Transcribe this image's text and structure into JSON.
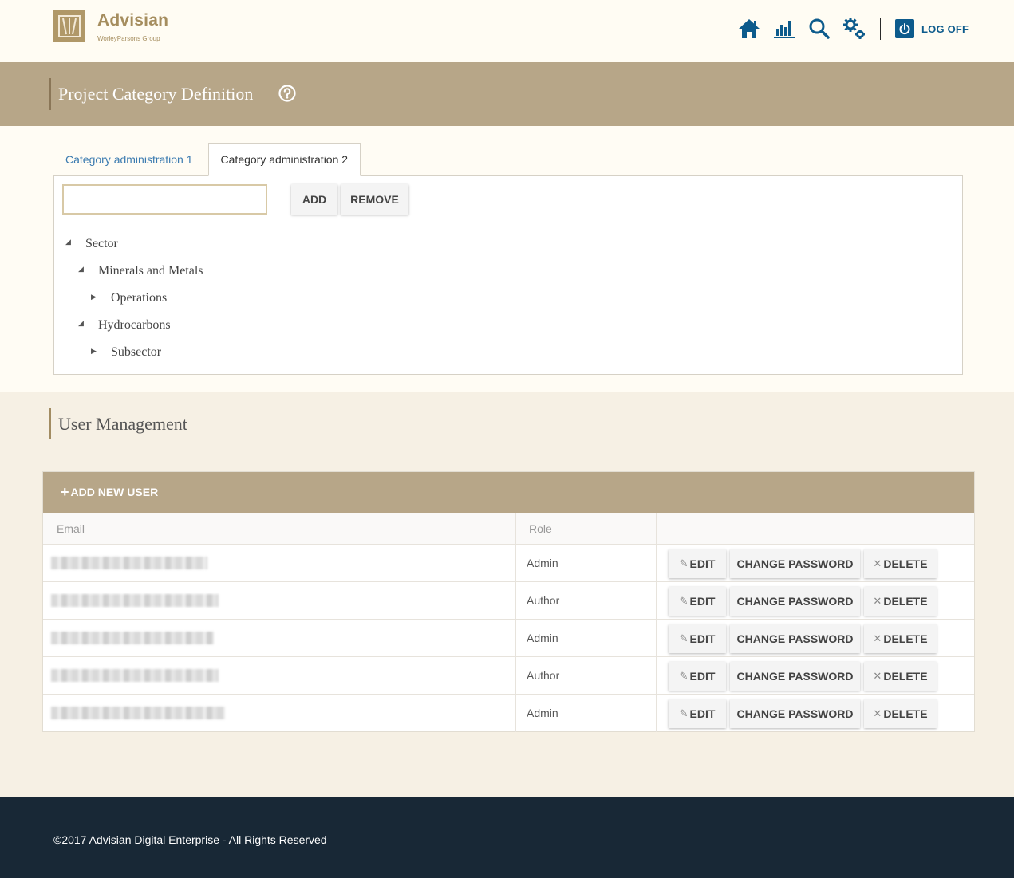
{
  "header": {
    "brand_name": "Advisian",
    "brand_sub": "WorleyParsons Group",
    "nav": [
      {
        "icon": "home-icon"
      },
      {
        "icon": "chart-icon"
      },
      {
        "icon": "search-icon"
      },
      {
        "icon": "gears-icon"
      }
    ],
    "logoff_label": "LOG OFF"
  },
  "title_band": {
    "title": "Project Category Definition",
    "help_icon": "question-circle-icon"
  },
  "categories": {
    "tabs": [
      {
        "label": "Category administration 1",
        "active": false
      },
      {
        "label": "Category administration 2",
        "active": true
      }
    ],
    "input_value": "",
    "add_label": "ADD",
    "remove_label": "REMOVE",
    "tree": [
      {
        "label": "Sector",
        "level": 0,
        "expanded": true
      },
      {
        "label": "Minerals and Metals",
        "level": 1,
        "expanded": true
      },
      {
        "label": "Operations",
        "level": 2,
        "expanded": false
      },
      {
        "label": "Hydrocarbons",
        "level": 1,
        "expanded": true
      },
      {
        "label": "Subsector",
        "level": 2,
        "expanded": false
      }
    ]
  },
  "users": {
    "title": "User Management",
    "add_new_label": "ADD NEW USER",
    "columns": {
      "email": "Email",
      "role": "Role"
    },
    "rows": [
      {
        "role": "Admin"
      },
      {
        "role": "Author"
      },
      {
        "role": "Admin"
      },
      {
        "role": "Author"
      },
      {
        "role": "Admin"
      }
    ],
    "edit_label": "EDIT",
    "change_password_label": "CHANGE PASSWORD",
    "delete_label": "DELETE"
  },
  "footer": {
    "text": "©2017 Advisian Digital Enterprise - All Rights Reserved"
  },
  "colors": {
    "accent_tan": "#b7a688",
    "brand_gold": "#a58d5e",
    "nav_blue": "#0d5b8c",
    "link_blue": "#3b7bb0",
    "footer_navy": "#182836"
  }
}
